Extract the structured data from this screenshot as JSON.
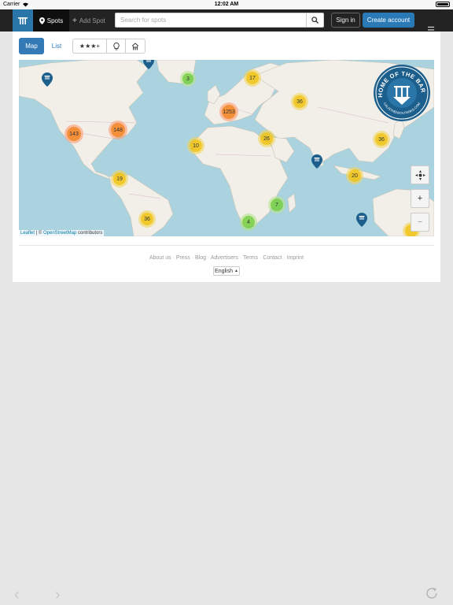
{
  "status_bar": {
    "carrier": "Carrier",
    "time": "12:02 AM"
  },
  "navbar": {
    "spots_label": "Spots",
    "add_spot_label": "Add Spot",
    "search_placeholder": "Search for spots",
    "signin_label": "Sign in",
    "create_account_label": "Create account"
  },
  "view_tabs": {
    "map": "Map",
    "list": "List"
  },
  "filters": {
    "stars": "★★★+"
  },
  "map": {
    "clusters": [
      {
        "label": "3",
        "color": "green"
      },
      {
        "label": "17",
        "color": "yellow"
      },
      {
        "label": "36",
        "color": "yellow"
      },
      {
        "label": "1253",
        "color": "orange"
      },
      {
        "label": "143",
        "color": "orange"
      },
      {
        "label": "148",
        "color": "orange"
      },
      {
        "label": "10",
        "color": "yellow"
      },
      {
        "label": "26",
        "color": "yellow"
      },
      {
        "label": "36",
        "color": "yellow"
      },
      {
        "label": "20",
        "color": "yellow"
      },
      {
        "label": "19",
        "color": "yellow"
      },
      {
        "label": "7",
        "color": "green"
      },
      {
        "label": "4",
        "color": "green"
      },
      {
        "label": "36",
        "color": "yellow"
      }
    ],
    "badge_text": {
      "top": "HOME OF THE BARS",
      "bottom": "CALISTHENICS-PARKS.COM"
    },
    "attribution": {
      "leaflet": "Leaflet",
      "separator": " | © ",
      "osm": "OpenStreetMap",
      "suffix": " contributors"
    },
    "zoom_in": "+",
    "zoom_out": "−"
  },
  "footer": {
    "links": [
      "About us",
      "Press",
      "Blog",
      "Advertisers",
      "Terms",
      "Contact",
      "Imprint"
    ],
    "language": "English"
  },
  "colors": {
    "brand": "#2a76a8",
    "primary": "#337ab7",
    "navbar": "#232323"
  }
}
